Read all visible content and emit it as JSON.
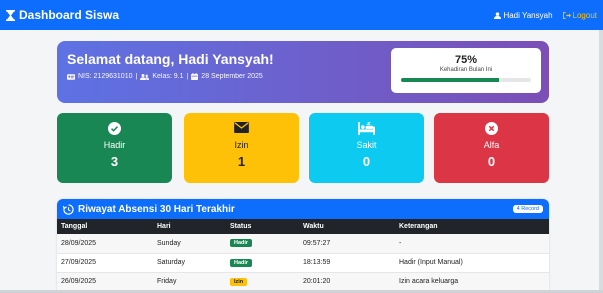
{
  "navbar": {
    "brand": "Dashboard Siswa",
    "user": "Hadi Yansyah",
    "logout": "Logout",
    "colors": {
      "bg": "#0d6efd",
      "logout": "#ffc107"
    }
  },
  "hero": {
    "greeting": "Selamat datang, Hadi Yansyah!",
    "nis": "NIS: 2129631010",
    "kelas": "Kelas: 9.1",
    "date": "28 September 2025",
    "sep": "|",
    "attendance_percent": "75%",
    "attendance_label": "Kehadiran Bulan Ini",
    "attendance_fraction": 0.75
  },
  "stats": [
    {
      "label": "Hadir",
      "value": "3",
      "icon": "check-circle-icon",
      "color": "#198754"
    },
    {
      "label": "Izin",
      "value": "1",
      "icon": "envelope-icon",
      "color": "#ffc107"
    },
    {
      "label": "Sakit",
      "value": "0",
      "icon": "bed-icon",
      "color": "#0dcaf0"
    },
    {
      "label": "Alfa",
      "value": "0",
      "icon": "x-circle-icon",
      "color": "#dc3545"
    }
  ],
  "history": {
    "title": "Riwayat Absensi 30 Hari Terakhir",
    "record_badge": "4 Record",
    "columns": [
      "Tanggal",
      "Hari",
      "Status",
      "Waktu",
      "Keterangan"
    ],
    "rows": [
      {
        "tanggal": "28/09/2025",
        "hari": "Sunday",
        "status": "Hadir",
        "waktu": "09:57:27",
        "keterangan": "-"
      },
      {
        "tanggal": "27/09/2025",
        "hari": "Saturday",
        "status": "Hadir",
        "waktu": "18:13:59",
        "keterangan": "Hadir (Input Manual)"
      },
      {
        "tanggal": "26/09/2025",
        "hari": "Friday",
        "status": "Izin",
        "waktu": "20:01:20",
        "keterangan": "Izin acara keluarga"
      }
    ]
  }
}
